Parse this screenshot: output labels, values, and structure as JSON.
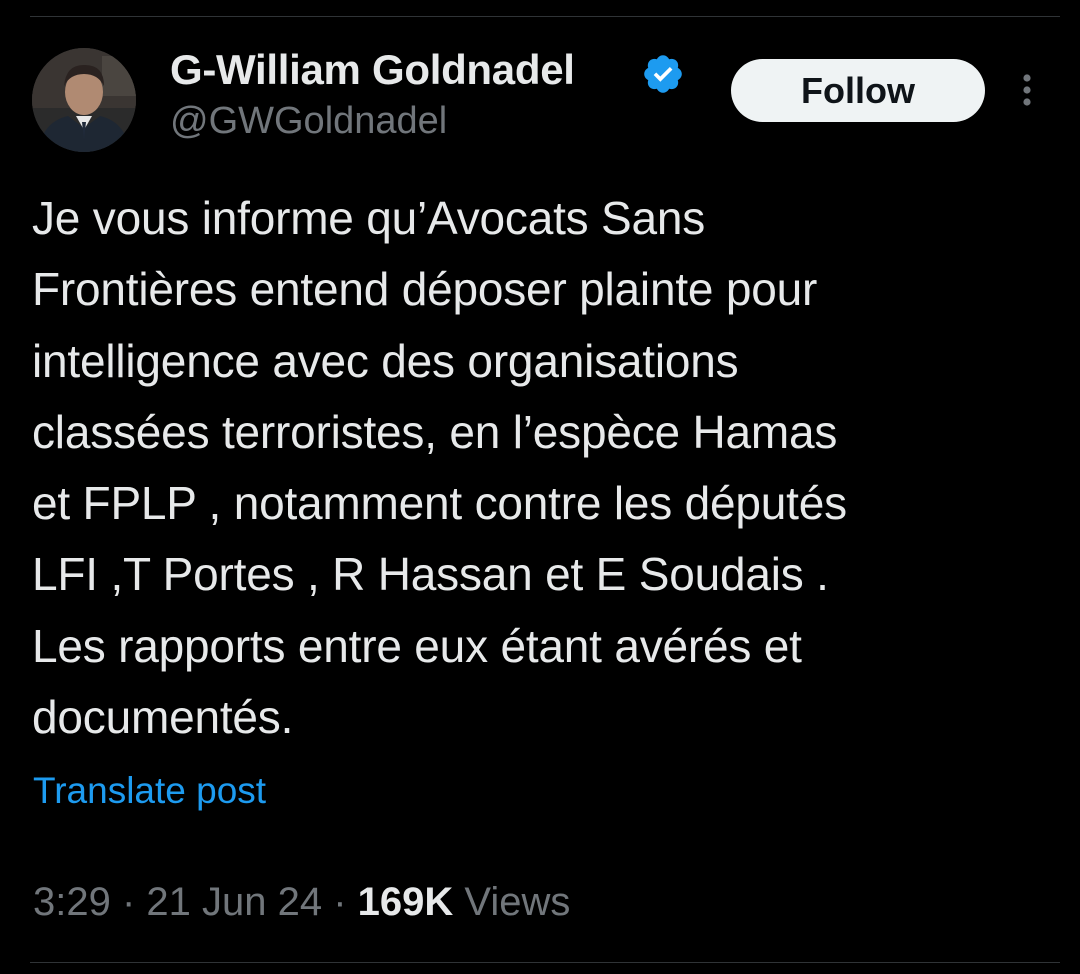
{
  "author": {
    "name": "G-William Goldnadel",
    "handle": "@GWGoldnadel",
    "verified_icon": "verified-badge-icon",
    "avatar": "profile-photo"
  },
  "follow_button": {
    "label": "Follow"
  },
  "more_menu": {
    "icon": "more-vertical-icon"
  },
  "tweet": {
    "text": "Je vous informe qu’Avocats Sans\nFrontières entend déposer plainte pour\nintelligence avec des organisations\nclassées terroristes, en l’espèce Hamas\net FPLP , notamment contre les députés\nLFI ,T Portes , R Hassan et E Soudais .\nLes rapports entre eux étant avérés et\ndocumentés."
  },
  "translate": {
    "label": "Translate post"
  },
  "meta": {
    "time": "3:29",
    "separator": " · ",
    "date": "21 Jun 24",
    "views_count": "169K",
    "views_label": " Views"
  },
  "colors": {
    "background": "#000000",
    "text_primary": "#e7e9ea",
    "text_secondary": "#71767b",
    "link": "#1d9bf0",
    "verified": "#1d9bf0",
    "follow_bg": "#eff3f4",
    "follow_text": "#0f1419",
    "divider": "#2f3336"
  }
}
